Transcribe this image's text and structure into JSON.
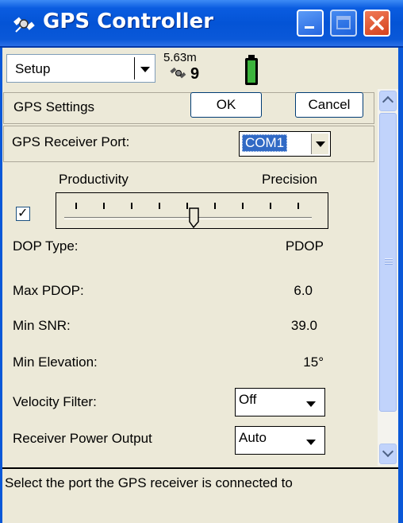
{
  "window": {
    "title": "GPS Controller"
  },
  "menubar": {
    "setup_label": "Setup",
    "accuracy": "5.63m",
    "satellites": "9",
    "icons": [
      "satellite-icon",
      "battery-icon"
    ]
  },
  "panel": {
    "header": "GPS Settings",
    "ok_label": "OK",
    "cancel_label": "Cancel",
    "receiver_port": {
      "label": "GPS Receiver Port:",
      "value": "COM1"
    },
    "slider": {
      "left_label": "Productivity",
      "right_label": "Precision",
      "checked": true,
      "ticks": 10,
      "position": 0.5
    },
    "dop_type": {
      "label": "DOP Type:",
      "value": "PDOP"
    },
    "max_pdop": {
      "label": "Max PDOP:",
      "value": "6.0"
    },
    "min_snr": {
      "label": "Min SNR:",
      "value": "39.0"
    },
    "min_elevation": {
      "label": "Min Elevation:",
      "value": "15°"
    },
    "velocity_filter": {
      "label": "Velocity Filter:",
      "value": "Off"
    },
    "receiver_power": {
      "label": "Receiver Power Output",
      "value": "Auto"
    }
  },
  "status": {
    "message": "Select the port the GPS receiver is connected to"
  },
  "colors": {
    "titlebar": "#0454d6",
    "close": "#d4421d",
    "background": "#ece9d8",
    "selection": "#316ac5"
  }
}
